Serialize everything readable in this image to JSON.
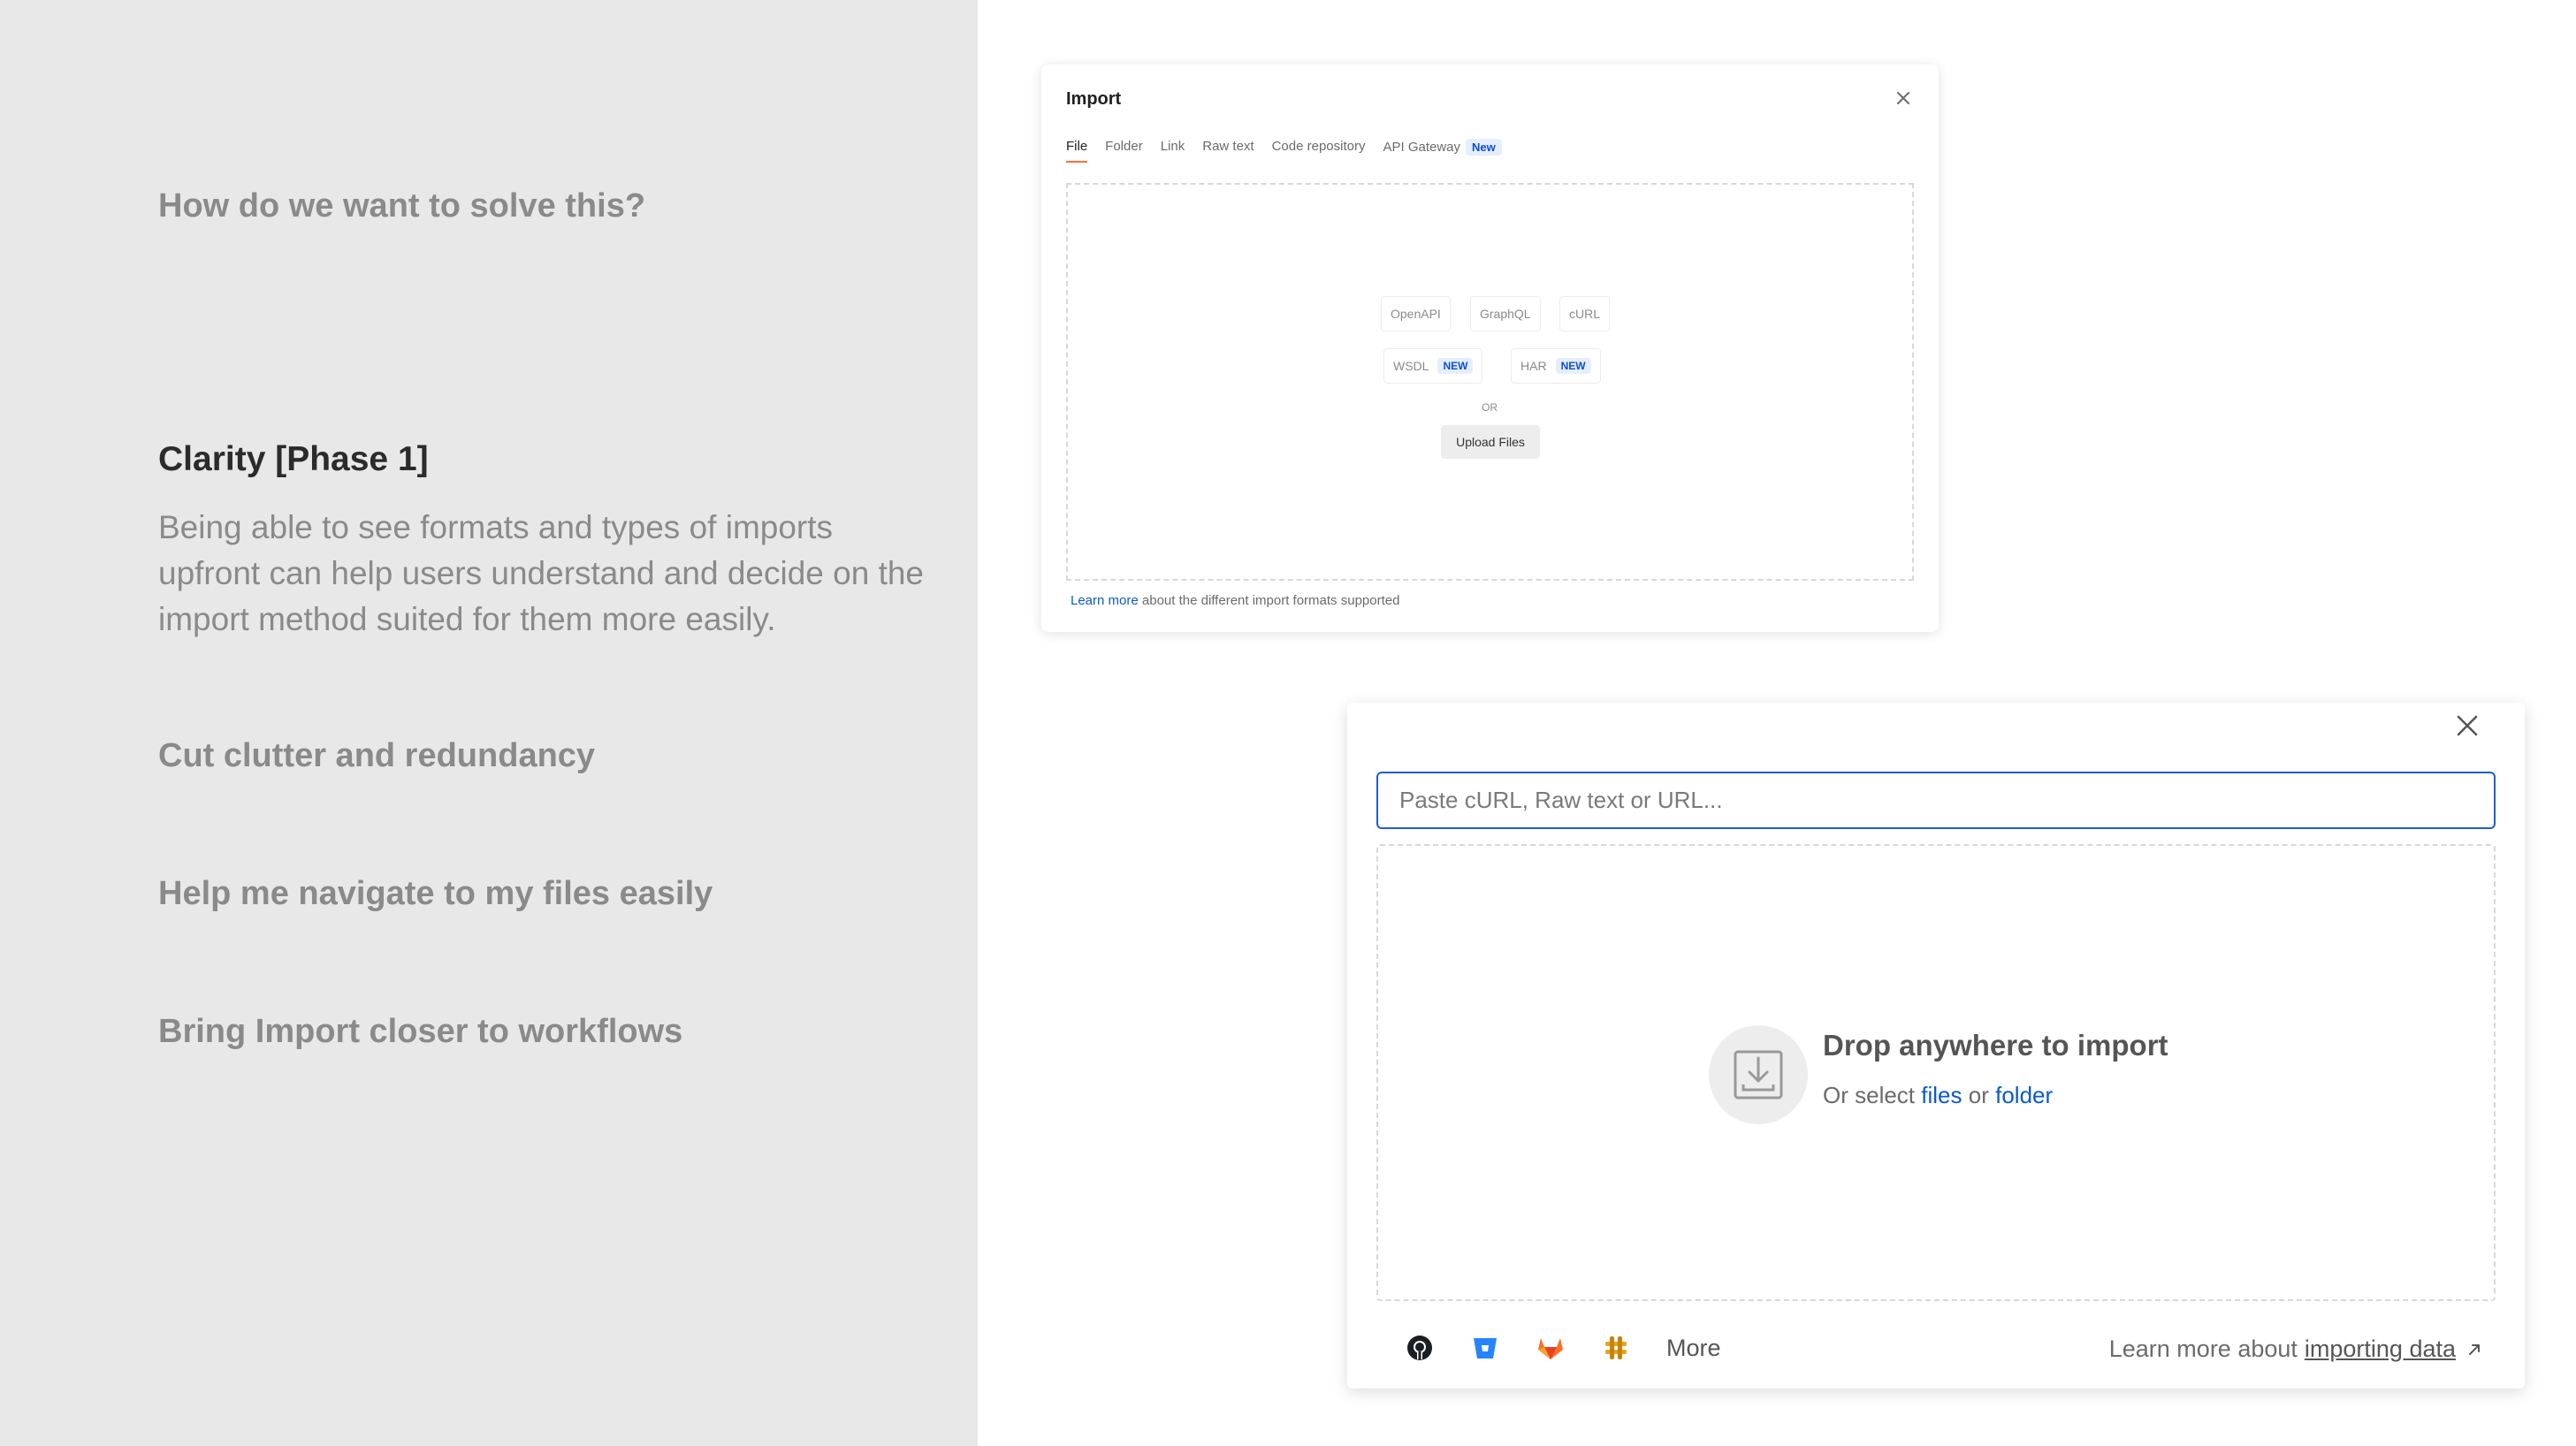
{
  "left": {
    "question": "How do we want to solve this?",
    "phase_heading": "Clarity [Phase 1]",
    "phase_text": "Being able to see formats and types of imports upfront can help users understand and decide on the import method suited for them more easily.",
    "point_1": "Cut clutter and redundancy",
    "point_2": "Help me navigate to my files easily",
    "point_3": "Bring Import closer to workflows"
  },
  "old_dialog": {
    "title": "Import",
    "tabs": [
      "File",
      "Folder",
      "Link",
      "Raw text",
      "Code repository",
      "API Gateway"
    ],
    "tab_badge": "New",
    "formats": [
      "OpenAPI",
      "GraphQL",
      "cURL",
      "WSDL",
      "HAR"
    ],
    "format_badge": "NEW",
    "or_label": "OR",
    "upload_label": "Upload Files",
    "footer_link": "Learn more",
    "footer_text": "about the different import formats supported",
    "accent_color": "#ff6c37",
    "link_color": "#0a5acc"
  },
  "new_modal": {
    "input_placeholder": "Paste cURL, Raw text or URL...",
    "drop_title": "Drop anywhere to import",
    "drop_prefix": "Or select",
    "drop_files": "files",
    "drop_or": "or",
    "drop_folder": "folder",
    "integrations": [
      "github-icon",
      "bitbucket-icon",
      "gitlab-icon",
      "azure-devops-icon"
    ],
    "more_label": "More",
    "learn_prefix": "Learn more about",
    "learn_link": "importing data",
    "focus_color": "#1f5ed3"
  }
}
